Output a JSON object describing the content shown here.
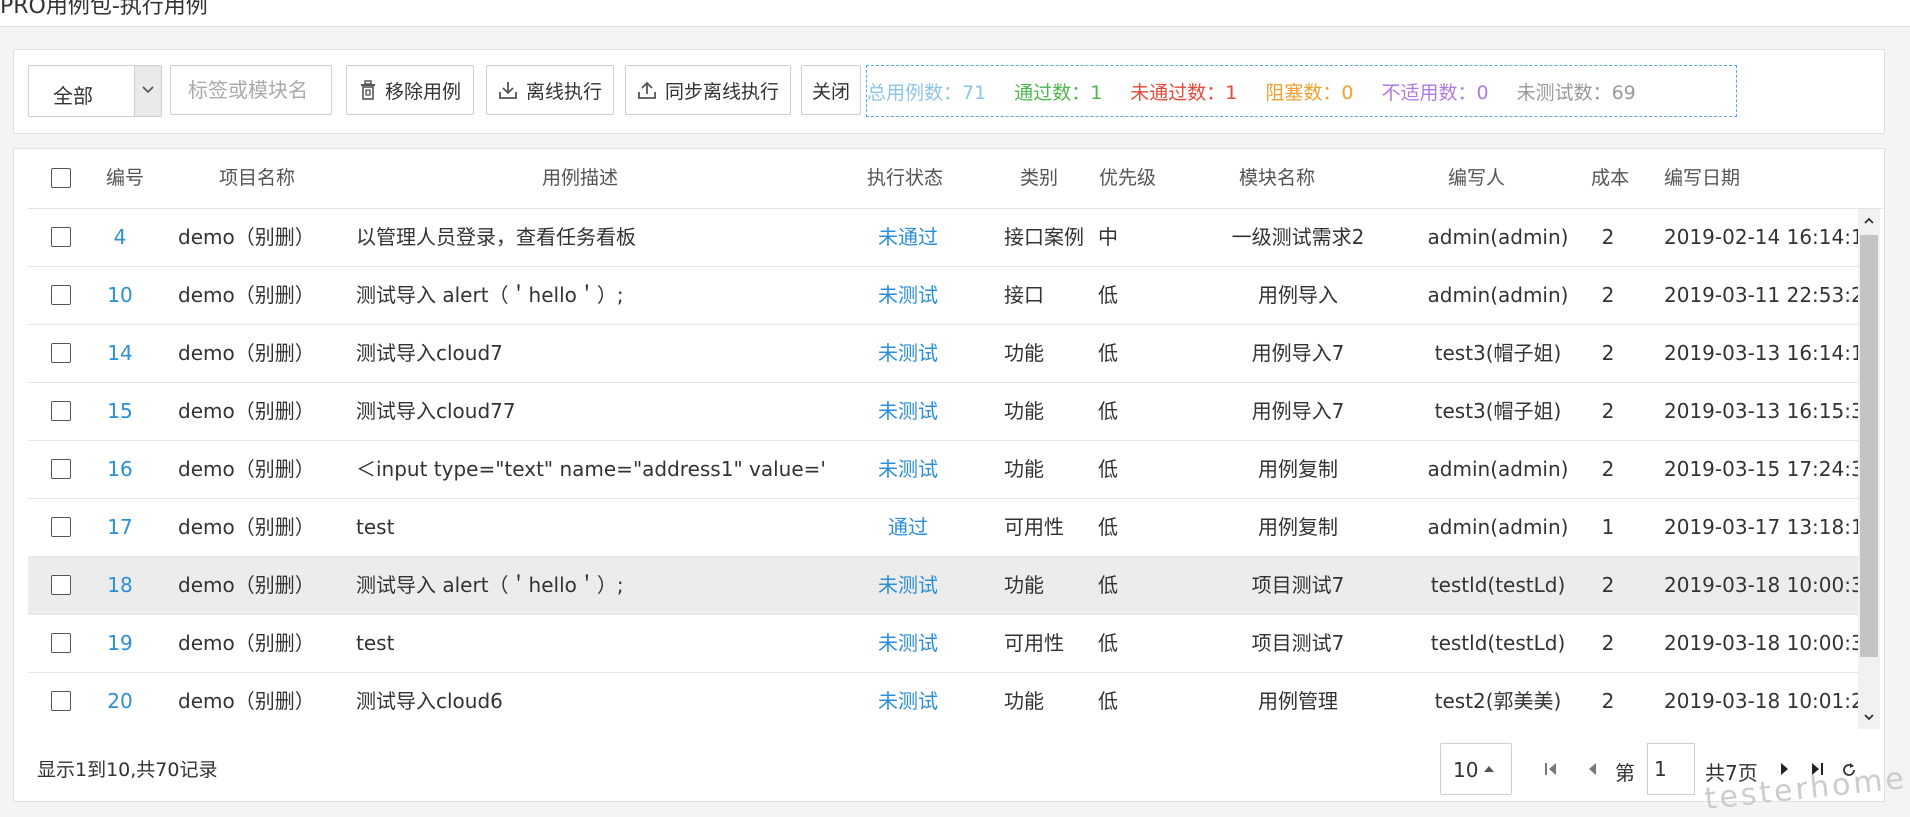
{
  "page_title": "PRO用例包-执行用例",
  "toolbar": {
    "filter_value": "全部",
    "search_placeholder": "标签或模块名",
    "remove_label": "移除用例",
    "offline_label": "离线执行",
    "sync_offline_label": "同步离线执行",
    "close_label": "关闭"
  },
  "stats": {
    "total": "总用例数：71",
    "passed": "通过数：1",
    "failed": "未通过数：1",
    "blocked": "阻塞数：0",
    "na": "不适用数：0",
    "untested": "未测试数：69",
    "colors": {
      "total": "#8ec5ea",
      "passed": "#4cb84c",
      "failed": "#e8473a",
      "blocked": "#f0a030",
      "na": "#b07ae0",
      "untested": "#999999"
    }
  },
  "table": {
    "headers": {
      "id": "编号",
      "project": "项目名称",
      "desc": "用例描述",
      "status": "执行状态",
      "category": "类别",
      "priority": "优先级",
      "module": "模块名称",
      "author": "编写人",
      "cost": "成本",
      "date": "编写日期"
    },
    "rows": [
      {
        "id": "4",
        "project": "demo（别删）",
        "desc": "以管理人员登录，查看任务看板",
        "status": "未通过",
        "category": "接口案例",
        "priority": "中",
        "module": "一级测试需求2",
        "author": "admin(admin)",
        "cost": "2",
        "date": "2019-02-14 16:14:1"
      },
      {
        "id": "10",
        "project": "demo（别删）",
        "desc": "测试导入 alert（＇hello＇）;",
        "status": "未测试",
        "category": "接口",
        "priority": "低",
        "module": "用例导入",
        "author": "admin(admin)",
        "cost": "2",
        "date": "2019-03-11 22:53:2"
      },
      {
        "id": "14",
        "project": "demo（别删）",
        "desc": "测试导入cloud7",
        "status": "未测试",
        "category": "功能",
        "priority": "低",
        "module": "用例导入7",
        "author": "test3(帽子姐)",
        "cost": "2",
        "date": "2019-03-13 16:14:1"
      },
      {
        "id": "15",
        "project": "demo（别删）",
        "desc": "测试导入cloud77",
        "status": "未测试",
        "category": "功能",
        "priority": "低",
        "module": "用例导入7",
        "author": "test3(帽子姐)",
        "cost": "2",
        "date": "2019-03-13 16:15:3"
      },
      {
        "id": "16",
        "project": "demo（别删）",
        "desc": "＜input type=\"text\" name=\"address1\" value='",
        "status": "未测试",
        "category": "功能",
        "priority": "低",
        "module": "用例复制",
        "author": "admin(admin)",
        "cost": "2",
        "date": "2019-03-15 17:24:3"
      },
      {
        "id": "17",
        "project": "demo（别删）",
        "desc": "test",
        "status": "通过",
        "category": "可用性",
        "priority": "低",
        "module": "用例复制",
        "author": "admin(admin)",
        "cost": "1",
        "date": "2019-03-17 13:18:1"
      },
      {
        "id": "18",
        "project": "demo（别删）",
        "desc": "测试导入 alert（＇hello＇）;",
        "status": "未测试",
        "category": "功能",
        "priority": "低",
        "module": "项目测试7",
        "author": "testld(testLd)",
        "cost": "2",
        "date": "2019-03-18 10:00:3"
      },
      {
        "id": "19",
        "project": "demo（别删）",
        "desc": "test",
        "status": "未测试",
        "category": "可用性",
        "priority": "低",
        "module": "项目测试7",
        "author": "testld(testLd)",
        "cost": "2",
        "date": "2019-03-18 10:00:3"
      },
      {
        "id": "20",
        "project": "demo（别删）",
        "desc": "测试导入cloud6",
        "status": "未测试",
        "category": "功能",
        "priority": "低",
        "module": "用例管理",
        "author": "test2(郭美美)",
        "cost": "2",
        "date": "2019-03-18 10:01:2"
      }
    ]
  },
  "footer": {
    "info": "显示1到10,共70记录",
    "page_size": "10",
    "page_prefix": "第",
    "page_value": "1",
    "page_total": "共7页"
  },
  "watermark": "testerhome.com"
}
